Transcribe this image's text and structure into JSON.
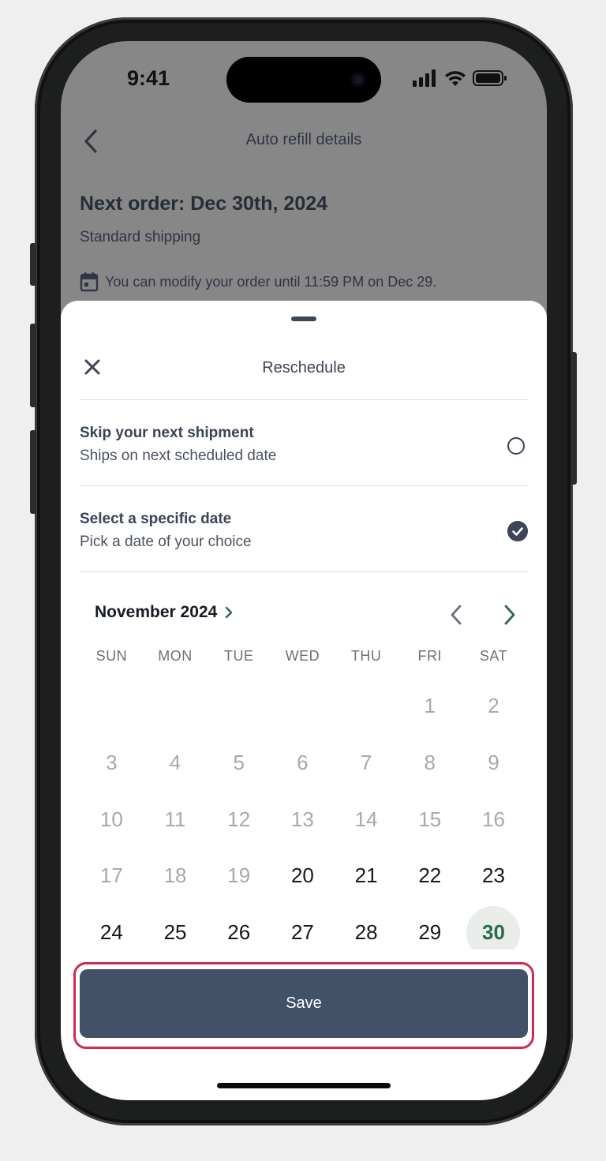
{
  "status_bar": {
    "time": "9:41"
  },
  "header": {
    "title": "Auto refill details"
  },
  "order": {
    "title": "Next order: Dec 30th, 2024",
    "shipping": "Standard shipping",
    "notice": "You can modify your order until 11:59 PM on Dec 29."
  },
  "sheet": {
    "title": "Reschedule",
    "options": [
      {
        "title": "Skip your next shipment",
        "subtitle": "Ships on next scheduled date",
        "selected": false
      },
      {
        "title": "Select a specific date",
        "subtitle": "Pick a date of your choice",
        "selected": true
      }
    ]
  },
  "calendar": {
    "month_label": "November 2024",
    "weekdays": [
      "SUN",
      "MON",
      "TUE",
      "WED",
      "THU",
      "FRI",
      "SAT"
    ],
    "weeks": [
      [
        "",
        "",
        "",
        "",
        "",
        "1",
        "2"
      ],
      [
        "3",
        "4",
        "5",
        "6",
        "7",
        "8",
        "9"
      ],
      [
        "10",
        "11",
        "12",
        "13",
        "14",
        "15",
        "16"
      ],
      [
        "17",
        "18",
        "19",
        "20",
        "21",
        "22",
        "23"
      ],
      [
        "24",
        "25",
        "26",
        "27",
        "28",
        "29",
        "30"
      ]
    ],
    "first_available_day": 20,
    "selected_day": 30,
    "colors": {
      "selected_text": "#2d6a4b",
      "selected_bg": "#e8ede9",
      "disabled": "#a5a9ae"
    }
  },
  "actions": {
    "save_label": "Save"
  },
  "colors": {
    "primary_button": "#425068",
    "highlight_outline": "#d22a52"
  }
}
